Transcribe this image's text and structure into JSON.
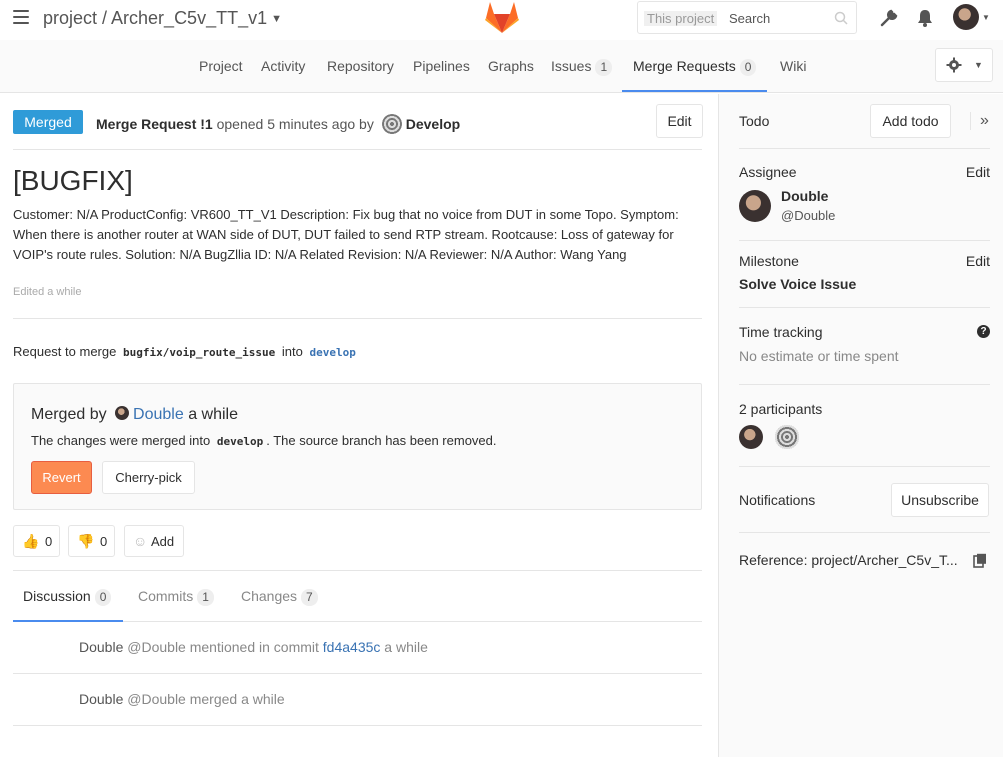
{
  "header": {
    "project_path": "project / Archer_C5v_TT_v1",
    "search_scope": "This project",
    "search_placeholder": "Search"
  },
  "nav": {
    "items": [
      {
        "label": "Project"
      },
      {
        "label": "Activity"
      },
      {
        "label": "Repository"
      },
      {
        "label": "Pipelines"
      },
      {
        "label": "Graphs"
      },
      {
        "label": "Issues",
        "count": "1"
      },
      {
        "label": "Merge Requests",
        "count": "0",
        "active": true
      },
      {
        "label": "Wiki"
      }
    ]
  },
  "mr": {
    "status": "Merged",
    "ref": "Merge Request !1",
    "opened_text": "opened 5 minutes ago by",
    "author": "Develop",
    "edit_label": "Edit",
    "title": "[BUGFIX]",
    "description": "Customer: N/A ProductConfig: VR600_TT_V1 Description: Fix bug that no voice from DUT in some Topo. Symptom: When there is another router at WAN side of DUT, DUT failed to send RTP stream. Rootcause: Loss of gateway for VOIP's route rules. Solution: N/A BugZllia ID: N/A Related Revision: N/A Reviewer: N/A Author: Wang Yang",
    "edited": "Edited a while",
    "request_prefix": "Request to merge",
    "source_branch": "bugfix/voip_route_issue",
    "into": "into",
    "target_branch": "develop"
  },
  "merged_box": {
    "prefix": "Merged by",
    "user": "Double",
    "when": "a while",
    "text_before": "The changes were merged into",
    "branch": "develop",
    "text_after": ". The source branch has been removed.",
    "revert_label": "Revert",
    "cherry_label": "Cherry-pick"
  },
  "awards": {
    "thumbs_up": "0",
    "thumbs_down": "0",
    "add_label": "Add"
  },
  "tabs": [
    {
      "label": "Discussion",
      "count": "0",
      "active": true
    },
    {
      "label": "Commits",
      "count": "1"
    },
    {
      "label": "Changes",
      "count": "7"
    }
  ],
  "notes": [
    {
      "who": "Double",
      "handle": "@Double",
      "text": "mentioned in commit",
      "sha": "fd4a435c",
      "when": "a while"
    },
    {
      "who": "Double",
      "handle": "@Double",
      "text": "merged a while"
    }
  ],
  "sidebar": {
    "todo_label": "Todo",
    "add_todo_label": "Add todo",
    "assignee_label": "Assignee",
    "assignee_edit": "Edit",
    "assignee_name": "Double",
    "assignee_handle": "@Double",
    "milestone_label": "Milestone",
    "milestone_edit": "Edit",
    "milestone_value": "Solve Voice Issue",
    "time_label": "Time tracking",
    "time_value": "No estimate or time spent",
    "participants_label": "2 participants",
    "notifications_label": "Notifications",
    "unsubscribe_label": "Unsubscribe",
    "reference": "Reference: project/Archer_C5v_T..."
  },
  "colors": {
    "merged_badge": "#2f9bd8",
    "revert": "#fc8a51",
    "link": "#3a73b3",
    "active_underline": "#4a8bee"
  }
}
